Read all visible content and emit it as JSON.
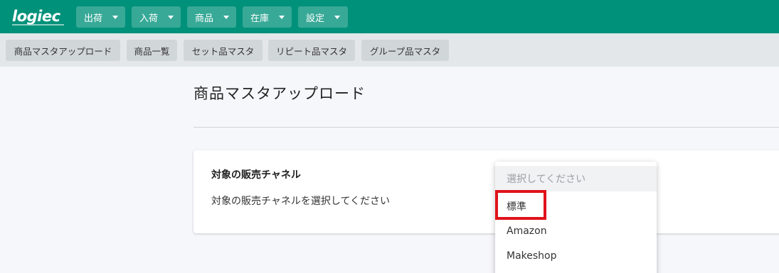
{
  "app": {
    "logo_text": "logiec"
  },
  "top_nav": [
    {
      "label": "出荷"
    },
    {
      "label": "入荷"
    },
    {
      "label": "商品"
    },
    {
      "label": "在庫"
    },
    {
      "label": "設定"
    }
  ],
  "sub_nav": [
    {
      "label": "商品マスタアップロード"
    },
    {
      "label": "商品一覧"
    },
    {
      "label": "セット品マスタ"
    },
    {
      "label": "リピート品マスタ"
    },
    {
      "label": "グループ品マスタ"
    }
  ],
  "page": {
    "title": "商品マスタアップロード"
  },
  "channel_field": {
    "label": "対象の販売チャネル",
    "description": "対象の販売チャネルを選択してください"
  },
  "channel_menu": {
    "placeholder": "選択してください",
    "options": [
      "標準",
      "Amazon",
      "Makeshop"
    ]
  },
  "colors": {
    "brand": "#00917a",
    "highlight": "#e0121b"
  }
}
